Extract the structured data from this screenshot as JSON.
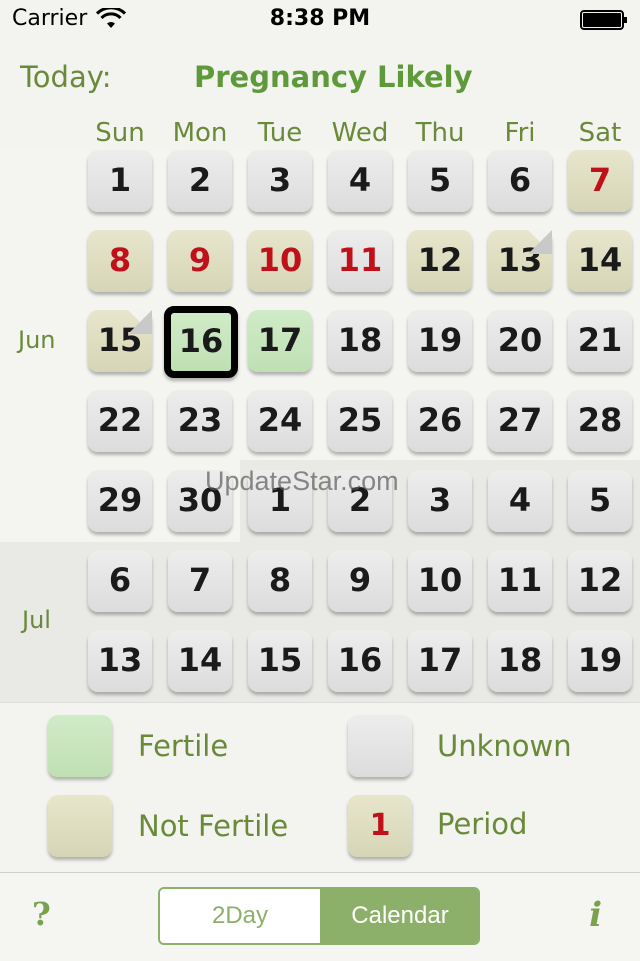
{
  "status_bar": {
    "carrier": "Carrier",
    "time": "8:38 PM"
  },
  "header": {
    "today_label": "Today:",
    "status": "Pregnancy Likely"
  },
  "weekdays": [
    "Sun",
    "Mon",
    "Tue",
    "Wed",
    "Thu",
    "Fri",
    "Sat"
  ],
  "months": {
    "jun": "Jun",
    "jul": "Jul"
  },
  "calendar": {
    "rows": [
      [
        {
          "day": "1",
          "state": "unknown"
        },
        {
          "day": "2",
          "state": "unknown"
        },
        {
          "day": "3",
          "state": "unknown"
        },
        {
          "day": "4",
          "state": "unknown"
        },
        {
          "day": "5",
          "state": "unknown"
        },
        {
          "day": "6",
          "state": "unknown"
        },
        {
          "day": "7",
          "state": "not-fertile-period"
        }
      ],
      [
        {
          "day": "8",
          "state": "not-fertile-period"
        },
        {
          "day": "9",
          "state": "not-fertile-period"
        },
        {
          "day": "10",
          "state": "not-fertile-period"
        },
        {
          "day": "11",
          "state": "unknown-period"
        },
        {
          "day": "12",
          "state": "not-fertile"
        },
        {
          "day": "13",
          "state": "not-fertile-note"
        },
        {
          "day": "14",
          "state": "not-fertile"
        }
      ],
      [
        {
          "day": "15",
          "state": "not-fertile-note"
        },
        {
          "day": "16",
          "state": "fertile-today"
        },
        {
          "day": "17",
          "state": "fertile"
        },
        {
          "day": "18",
          "state": "unknown"
        },
        {
          "day": "19",
          "state": "unknown"
        },
        {
          "day": "20",
          "state": "unknown"
        },
        {
          "day": "21",
          "state": "unknown"
        }
      ],
      [
        {
          "day": "22",
          "state": "unknown"
        },
        {
          "day": "23",
          "state": "unknown"
        },
        {
          "day": "24",
          "state": "unknown"
        },
        {
          "day": "25",
          "state": "unknown"
        },
        {
          "day": "26",
          "state": "unknown"
        },
        {
          "day": "27",
          "state": "unknown"
        },
        {
          "day": "28",
          "state": "unknown"
        }
      ],
      [
        {
          "day": "29",
          "state": "unknown"
        },
        {
          "day": "30",
          "state": "unknown"
        },
        {
          "day": "1",
          "state": "unknown"
        },
        {
          "day": "2",
          "state": "unknown"
        },
        {
          "day": "3",
          "state": "unknown"
        },
        {
          "day": "4",
          "state": "unknown"
        },
        {
          "day": "5",
          "state": "unknown"
        }
      ],
      [
        {
          "day": "6",
          "state": "unknown"
        },
        {
          "day": "7",
          "state": "unknown"
        },
        {
          "day": "8",
          "state": "unknown"
        },
        {
          "day": "9",
          "state": "unknown"
        },
        {
          "day": "10",
          "state": "unknown"
        },
        {
          "day": "11",
          "state": "unknown"
        },
        {
          "day": "12",
          "state": "unknown"
        }
      ],
      [
        {
          "day": "13",
          "state": "unknown"
        },
        {
          "day": "14",
          "state": "unknown"
        },
        {
          "day": "15",
          "state": "unknown"
        },
        {
          "day": "16",
          "state": "unknown"
        },
        {
          "day": "17",
          "state": "unknown"
        },
        {
          "day": "18",
          "state": "unknown"
        },
        {
          "day": "19",
          "state": "unknown"
        }
      ]
    ]
  },
  "watermark": "UpdateStar.com",
  "legend": {
    "fertile": "Fertile",
    "unknown": "Unknown",
    "not_fertile": "Not Fertile",
    "period": "Period",
    "period_sample": "1"
  },
  "bottom_bar": {
    "help": "?",
    "info": "i",
    "segments": [
      "2Day",
      "Calendar"
    ],
    "selected_segment": "Calendar"
  },
  "colors": {
    "accent_green": "#6a8a3a",
    "fertile": "#c8e6bf",
    "not_fertile": "#dedcc0",
    "unknown": "#e2e2e2",
    "period_red": "#c0101a",
    "segment_green": "#8cb06a"
  }
}
